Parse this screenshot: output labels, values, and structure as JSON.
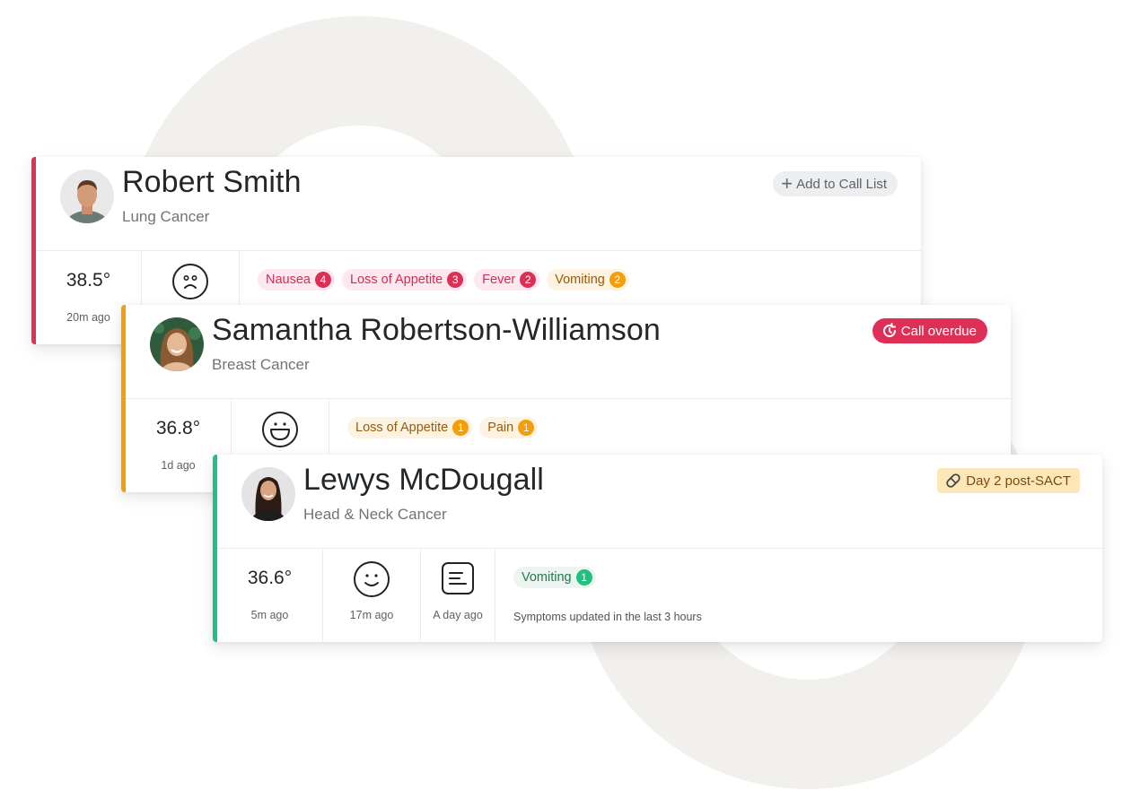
{
  "patients": [
    {
      "name": "Robert Smith",
      "condition": "Lung Cancer",
      "status_color": "#df3158",
      "action": {
        "type": "button",
        "label": "Add to Call List",
        "icon": "plus-icon"
      },
      "temperature": {
        "value": "38.5°",
        "time_ago": "20m ago"
      },
      "mood": {
        "icon": "sad-face-icon"
      },
      "symptoms": [
        {
          "label": "Nausea",
          "count": "4",
          "severity": "red"
        },
        {
          "label": "Loss of Appetite",
          "count": "3",
          "severity": "red"
        },
        {
          "label": "Fever",
          "count": "2",
          "severity": "red"
        },
        {
          "label": "Vomiting",
          "count": "2",
          "severity": "amber"
        }
      ]
    },
    {
      "name": "Samantha Robertson-Williamson",
      "condition": "Breast Cancer",
      "status_color": "#f59e0b",
      "action": {
        "type": "badge",
        "label": "Call overdue",
        "icon": "clock-refresh-icon",
        "color": "#de2f57"
      },
      "temperature": {
        "value": "36.8°",
        "time_ago": "1d ago"
      },
      "mood": {
        "icon": "laughing-face-icon"
      },
      "symptoms": [
        {
          "label": "Loss of Appetite",
          "count": "1",
          "severity": "amber"
        },
        {
          "label": "Pain",
          "count": "1",
          "severity": "amber"
        }
      ]
    },
    {
      "name": "Lewys McDougall",
      "condition": "Head & Neck Cancer",
      "status_color": "#20c083",
      "action": {
        "type": "badge",
        "label": "Day 2 post-SACT",
        "icon": "pill-icon",
        "color": "#fde7b8"
      },
      "temperature": {
        "value": "36.6°",
        "time_ago": "5m ago"
      },
      "mood": {
        "icon": "smile-face-icon",
        "time_ago": "17m ago"
      },
      "note": {
        "icon": "note-icon",
        "time_ago": "A day ago"
      },
      "symptoms": [
        {
          "label": "Vomiting",
          "count": "1",
          "severity": "green"
        }
      ],
      "symptoms_note": "Symptoms updated in the last 3 hours"
    }
  ]
}
